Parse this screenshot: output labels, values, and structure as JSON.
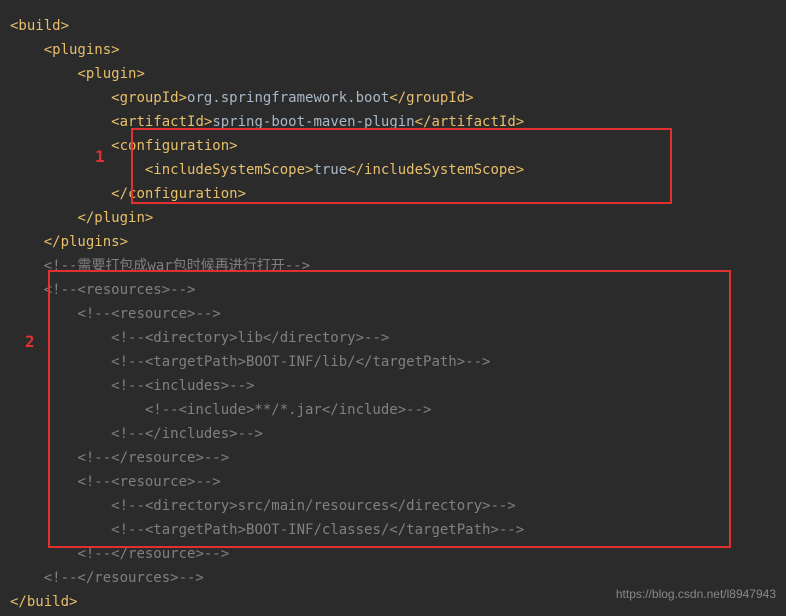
{
  "annotations": {
    "label1": "1",
    "label2": "2"
  },
  "watermark": "https://blog.csdn.net/l8947943",
  "code": {
    "l1_open": "<build>",
    "l2_open": "<plugins>",
    "l3_open": "<plugin>",
    "l4_groupid_open": "<groupId>",
    "l4_groupid_text": "org.springframework.boot",
    "l4_groupid_close": "</groupId>",
    "l5_artifact_open": "<artifactId>",
    "l5_artifact_text": "spring-boot-maven-plugin",
    "l5_artifact_close": "</artifactId>",
    "l6_config_open": "<configuration>",
    "l7_scope_open": "<includeSystemScope>",
    "l7_scope_text": "true",
    "l7_scope_close": "</includeSystemScope>",
    "l8_config_close": "</configuration>",
    "l9_plugin_close": "</plugin>",
    "l10_plugins_close": "</plugins>",
    "l11_comment": "<!--需要打包成war包时候再进行打开-->",
    "l12_comment": "<!--<resources>-->",
    "l13_comment": "<!--<resource>-->",
    "l14_comment": "<!--<directory>lib</directory>-->",
    "l15_comment": "<!--<targetPath>BOOT-INF/lib/</targetPath>-->",
    "l16_comment": "<!--<includes>-->",
    "l17_comment": "<!--<include>**/*.jar</include>-->",
    "l18_comment": "<!--</includes>-->",
    "l19_comment": "<!--</resource>-->",
    "l20_comment": "<!--<resource>-->",
    "l21_comment": "<!--<directory>src/main/resources</directory>-->",
    "l22_comment": "<!--<targetPath>BOOT-INF/classes/</targetPath>-->",
    "l23_comment": "<!--</resource>-->",
    "l24_comment": "<!--</resources>-->",
    "l25_build_close": "</build>"
  }
}
